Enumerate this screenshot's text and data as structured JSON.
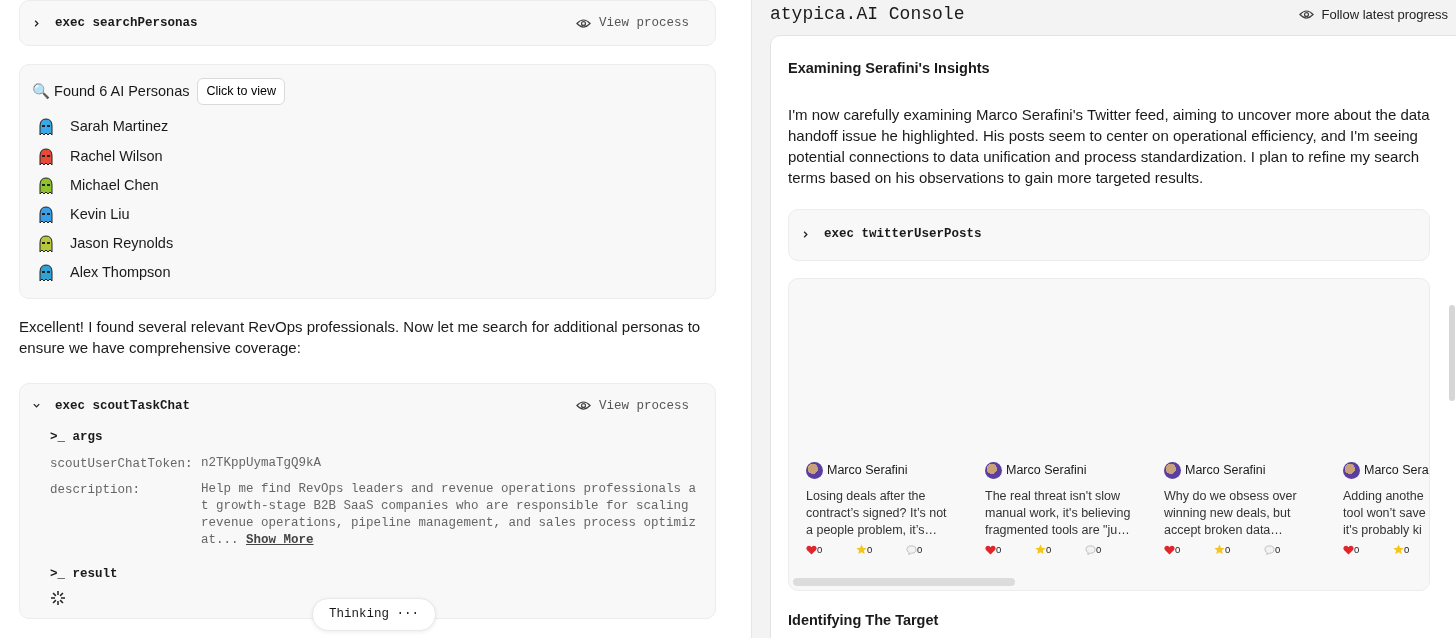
{
  "left": {
    "search_call": {
      "prefix": "exec",
      "tool": "searchPersonas",
      "expanded": false,
      "view_label": "View process"
    },
    "personas_card": {
      "icon": "🔍",
      "title": "Found 6 AI Personas",
      "button": "Click to view",
      "personas": [
        {
          "name": "Sarah Martinez",
          "color": "#3aa7e8"
        },
        {
          "name": "Rachel Wilson",
          "color": "#e84a3a"
        },
        {
          "name": "Michael Chen",
          "color": "#8fc22b"
        },
        {
          "name": "Kevin Liu",
          "color": "#3a9de8"
        },
        {
          "name": "Jason Reynolds",
          "color": "#b8c83a"
        },
        {
          "name": "Alex Thompson",
          "color": "#2fa3d6"
        }
      ]
    },
    "message": "Excellent! I found several relevant RevOps professionals. Now let me search for additional personas to ensure we have comprehensive coverage:",
    "scout_call": {
      "prefix": "exec",
      "tool": "scoutTaskChat",
      "expanded": true,
      "view_label": "View process",
      "args_label": ">_ args",
      "args": [
        {
          "key": "scoutUserChatToken:",
          "value": "n2TKppUymaTgQ9kA"
        },
        {
          "key": "description:",
          "value": "Help me find RevOps leaders and revenue operations professionals at growth-stage B2B SaaS companies who are responsible for scaling revenue operations, pipeline management, and sales process optimizat...",
          "more": "Show More"
        }
      ],
      "result_label": ">_ result",
      "loading": true
    },
    "thinking": "Thinking ···"
  },
  "right": {
    "title": "atypica.AI Console",
    "follow_label": "Follow latest progress",
    "heading": "Examining Serafini's Insights",
    "paragraph": "I'm now carefully examining Marco Serafini's Twitter feed, aiming to uncover more about the data handoff issue he highlighted. His posts seem to center on operational efficiency, and I'm seeing potential connections to data unification and process standardization. I plan to refine my search terms based on his observations to gain more targeted results.",
    "twitter_call": {
      "prefix": "exec",
      "tool": "twitterUserPosts",
      "expanded": false
    },
    "posts": [
      {
        "author": "Marco Serafini",
        "lines": [
          "Losing deals after the",
          "contract’s signed? It’s not",
          "a people problem, it’s…"
        ],
        "likes": "0",
        "stars": "0",
        "comments": "0"
      },
      {
        "author": "Marco Serafini",
        "lines": [
          "The real threat isn't slow",
          "manual work, it's believing",
          "fragmented tools are \"ju…"
        ],
        "likes": "0",
        "stars": "0",
        "comments": "0"
      },
      {
        "author": "Marco Serafini",
        "lines": [
          "Why do we obsess over",
          "winning new deals, but",
          "accept broken data…"
        ],
        "likes": "0",
        "stars": "0",
        "comments": "0"
      },
      {
        "author": "Marco Sera",
        "lines": [
          "Adding anothe",
          "tool won’t save",
          "it's probably ki"
        ],
        "likes": "0",
        "stars": "0"
      }
    ],
    "next_heading": "Identifying The Target"
  }
}
